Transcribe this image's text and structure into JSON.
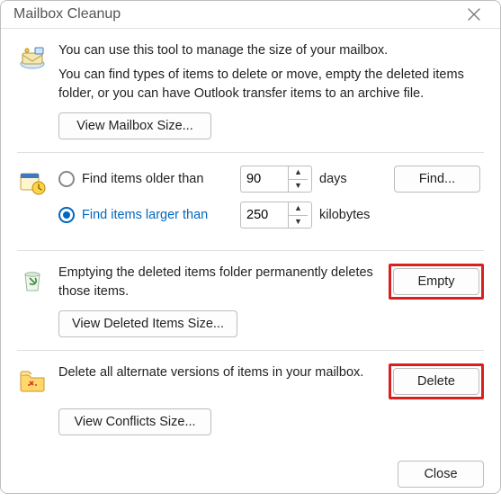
{
  "window": {
    "title": "Mailbox Cleanup"
  },
  "intro": {
    "line1": "You can use this tool to manage the size of your mailbox.",
    "line2": "You can find types of items to delete or move, empty the deleted items folder, or you can have Outlook transfer items to an archive file.",
    "view_mailbox_size": "View Mailbox Size..."
  },
  "find": {
    "older_label": "Find items older than",
    "older_value": "90",
    "older_unit": "days",
    "larger_label": "Find items larger than",
    "larger_value": "250",
    "larger_unit": "kilobytes",
    "selected": "larger",
    "find_button": "Find..."
  },
  "deleted": {
    "desc": "Emptying the deleted items folder permanently deletes those items.",
    "empty_button": "Empty",
    "view_deleted_size": "View Deleted Items Size..."
  },
  "conflicts": {
    "desc": "Delete all alternate versions of items in your mailbox.",
    "delete_button": "Delete",
    "view_conflicts_size": "View Conflicts Size..."
  },
  "footer": {
    "close": "Close"
  }
}
